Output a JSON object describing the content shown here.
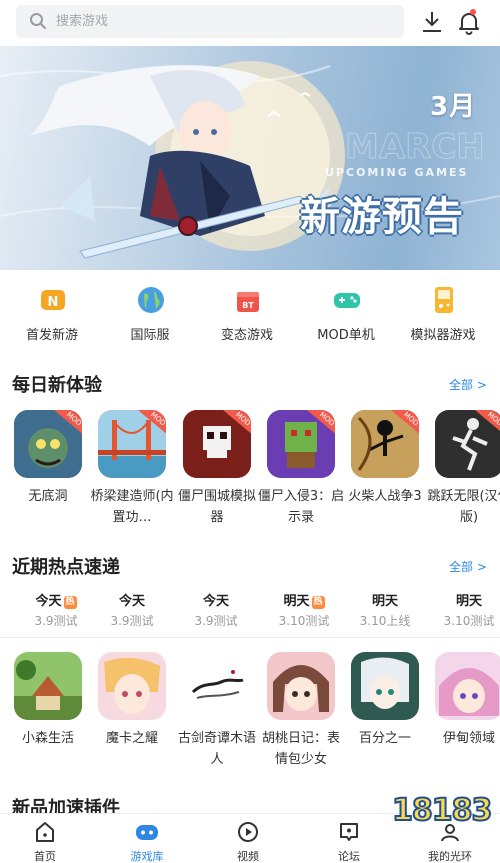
{
  "search": {
    "placeholder": "搜索游戏"
  },
  "banner": {
    "month": "3月",
    "subtitle": "UPCOMING GAMES",
    "title": "新游预告",
    "dots": 5,
    "active_dot": 2
  },
  "categories": [
    {
      "label": "首发新游",
      "icon": "new-release-icon",
      "color": "#f5a623"
    },
    {
      "label": "国际服",
      "icon": "globe-icon",
      "color": "#4a9fe0"
    },
    {
      "label": "变态游戏",
      "icon": "bt-gift-icon",
      "color": "#f0554c"
    },
    {
      "label": "MOD单机",
      "icon": "gamepad-icon",
      "color": "#2fc5a8"
    },
    {
      "label": "模拟器游戏",
      "icon": "emulator-icon",
      "color": "#f7b733"
    }
  ],
  "daily": {
    "title": "每日新体验",
    "all_label": "全部 >",
    "games": [
      {
        "name": "无底洞",
        "badge": "MOD",
        "icon": "game-icon-wudidong",
        "color": "#4a6c8c"
      },
      {
        "name": "桥梁建造师(内置功…",
        "badge": "MOD",
        "icon": "game-icon-bridge",
        "color": "#e07a3a"
      },
      {
        "name": "僵尸围城模拟器",
        "badge": "MOD",
        "icon": "game-icon-zombie-siege",
        "color": "#8a2a23"
      },
      {
        "name": "僵尸入侵3：启示录",
        "badge": "MOD",
        "icon": "game-icon-zombie-invasion",
        "color": "#6d3fb0"
      },
      {
        "name": "火柴人战争3",
        "badge": "MOD",
        "icon": "game-icon-stickman-war",
        "color": "#7a5a36"
      },
      {
        "name": "跳跃无限(汉化版)",
        "badge": "MOD",
        "icon": "game-icon-jump",
        "color": "#3a3a3a"
      }
    ]
  },
  "hot": {
    "title": "近期热点速递",
    "all_label": "全部 >",
    "dates": [
      {
        "day": "今天",
        "hot": true,
        "sub": "3.9测试"
      },
      {
        "day": "今天",
        "hot": false,
        "sub": "3.9测试"
      },
      {
        "day": "今天",
        "hot": false,
        "sub": "3.9测试"
      },
      {
        "day": "明天",
        "hot": true,
        "sub": "3.10测试"
      },
      {
        "day": "明天",
        "hot": false,
        "sub": "3.10上线"
      },
      {
        "day": "明天",
        "hot": false,
        "sub": "3.10测试"
      }
    ],
    "hot_badge": "热",
    "games": [
      {
        "name": "小森生活",
        "icon": "game-icon-xiaosen",
        "color": "#5e8a3a"
      },
      {
        "name": "魔卡之耀",
        "icon": "game-icon-moka",
        "color": "#f3b7c2"
      },
      {
        "name": "古剑奇谭木语人",
        "icon": "game-icon-gujian",
        "color": "#ececec"
      },
      {
        "name": "胡桃日记：表情包少女",
        "icon": "game-icon-hutao",
        "color": "#c98a6a"
      },
      {
        "name": "百分之一",
        "icon": "game-icon-baifen",
        "color": "#3a7c6d"
      },
      {
        "name": "伊甸领域",
        "icon": "game-icon-yidian",
        "color": "#e7a9d1"
      }
    ]
  },
  "next_section": {
    "title": "新品加速插件"
  },
  "nav": [
    {
      "label": "首页",
      "icon": "home-icon",
      "active": false
    },
    {
      "label": "游戏库",
      "icon": "game-library-icon",
      "active": true
    },
    {
      "label": "视频",
      "icon": "video-icon",
      "active": false
    },
    {
      "label": "论坛",
      "icon": "forum-icon",
      "active": false
    },
    {
      "label": "我的光环",
      "icon": "profile-icon",
      "active": false
    }
  ],
  "watermark": "18183",
  "colors": {
    "accent": "#2d87e3",
    "mod_badge": "#f15b4b",
    "hot_badge": "#ff8a3d"
  }
}
